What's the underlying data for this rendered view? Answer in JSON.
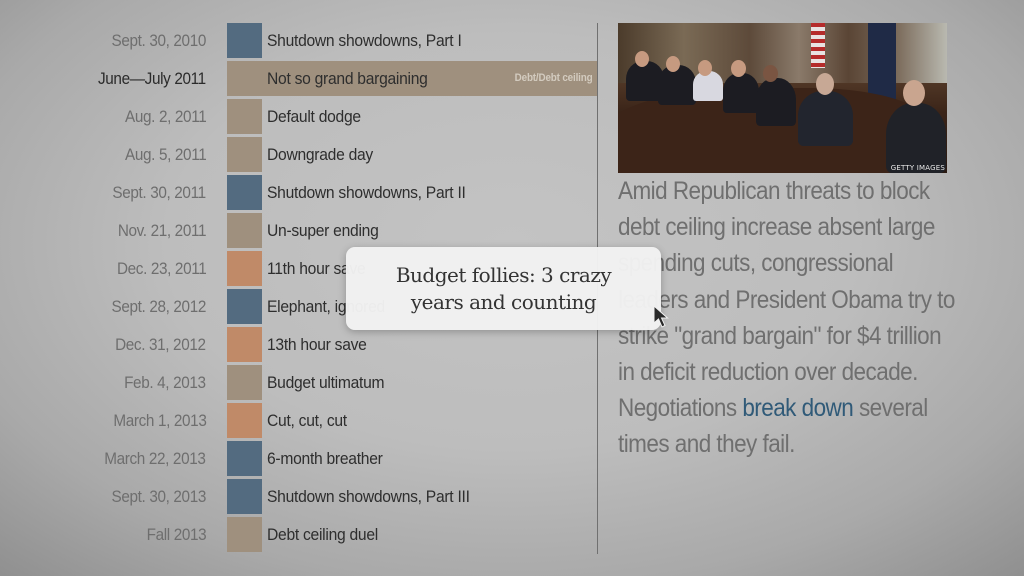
{
  "tooltip": {
    "text": "Budget follies: 3 crazy years and counting"
  },
  "timeline": {
    "items": [
      {
        "date": "Sept. 30, 2010",
        "title": "Shutdown showdowns, Part I",
        "color": "#536b80",
        "active": false
      },
      {
        "date": "June—July 2011",
        "title": "Not so grand bargaining",
        "color": "#9f907e",
        "active": true,
        "category": "Debt/Debt ceiling"
      },
      {
        "date": "Aug. 2, 2011",
        "title": "Default dodge",
        "color": "#9f907e",
        "active": false
      },
      {
        "date": "Aug. 5, 2011",
        "title": "Downgrade day",
        "color": "#9f907e",
        "active": false
      },
      {
        "date": "Sept. 30, 2011",
        "title": "Shutdown showdowns, Part II",
        "color": "#536b80",
        "active": false
      },
      {
        "date": "Nov. 21, 2011",
        "title": "Un-super ending",
        "color": "#9f907e",
        "active": false
      },
      {
        "date": "Dec. 23, 2011",
        "title": "11th hour save",
        "color": "#c08a68",
        "active": false
      },
      {
        "date": "Sept. 28, 2012",
        "title": "Elephant, ignored",
        "color": "#536b80",
        "active": false
      },
      {
        "date": "Dec. 31, 2012",
        "title": "13th hour save",
        "color": "#c08a68",
        "active": false
      },
      {
        "date": "Feb. 4, 2013",
        "title": "Budget ultimatum",
        "color": "#9f907e",
        "active": false
      },
      {
        "date": "March 1, 2013",
        "title": "Cut, cut, cut",
        "color": "#c08a68",
        "active": false
      },
      {
        "date": "March 22, 2013",
        "title": "6-month breather",
        "color": "#536b80",
        "active": false
      },
      {
        "date": "Sept. 30, 2013",
        "title": "Shutdown showdowns, Part III",
        "color": "#536b80",
        "active": false
      },
      {
        "date": "Fall 2013",
        "title": "Debt ceiling duel",
        "color": "#9f907e",
        "active": false
      }
    ]
  },
  "detail": {
    "photo_credit": "GETTY IMAGES",
    "photo_alt": "Congressional leaders and President Obama at a conference table",
    "text_before_link": "Amid Republican threats to block debt ceiling increase absent large spending cuts, congressional leaders and President Obama try to strike \"grand bargain\" for $4 trillion in deficit reduction over decade. Negotiations ",
    "link_text": "break down",
    "text_after_link": " several times and they fail.",
    "link_color": "#305a78"
  }
}
